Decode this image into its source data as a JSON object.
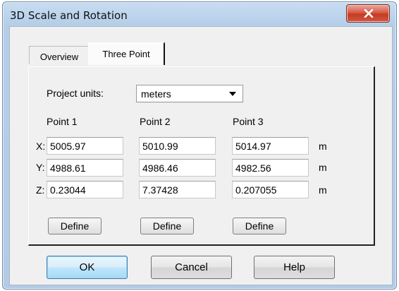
{
  "window": {
    "title": "3D Scale and Rotation"
  },
  "tabs": [
    {
      "label": "Overview",
      "selected": false
    },
    {
      "label": "Three Point",
      "selected": true
    }
  ],
  "project_units": {
    "label": "Project units:",
    "value": "meters"
  },
  "points": {
    "headers": [
      "Point 1",
      "Point 2",
      "Point 3"
    ],
    "row_labels": [
      "X:",
      "Y:",
      "Z:"
    ],
    "unit": "m",
    "values": [
      [
        "5005.97",
        "5010.99",
        "5014.97"
      ],
      [
        "4988.61",
        "4986.46",
        "4982.56"
      ],
      [
        "0.23044",
        "7.37428",
        "0.207055"
      ]
    ],
    "define_label": "Define"
  },
  "buttons": {
    "ok": "OK",
    "cancel": "Cancel",
    "help": "Help"
  }
}
